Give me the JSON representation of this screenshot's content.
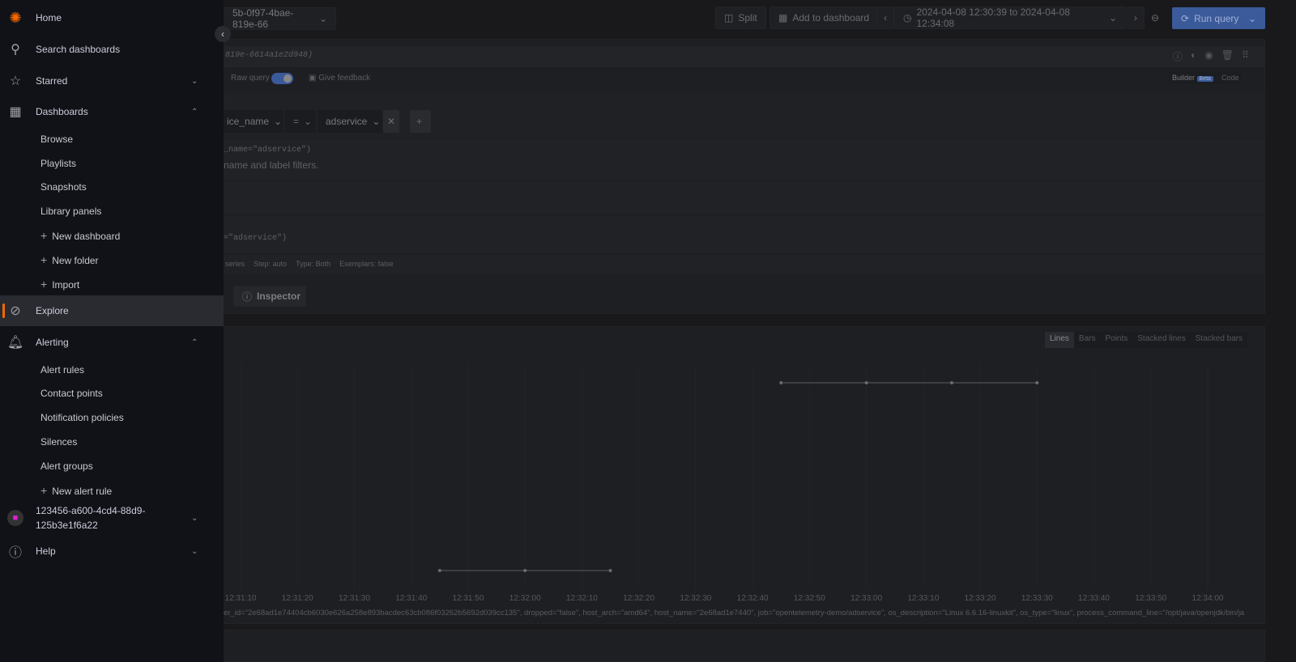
{
  "toolbar": {
    "datasource": "5b-0f97-4bae-819e-66",
    "split": "Split",
    "add_to_dashboard": "Add to dashboard",
    "time_range": "2024-04-08 12:30:39 to 2024-04-08 12:34:08",
    "run_query": "Run query"
  },
  "query": {
    "ref": "819e-6614a1e2d948)",
    "raw_query_label": "Raw query",
    "raw_query_on": true,
    "give_feedback": "Give feedback",
    "builder": "Builder",
    "beta": "Beta",
    "code": "Code",
    "label_name": "ice_name",
    "operator": "=",
    "label_value": "adservice",
    "preview_code": "_name=\"adservice\")",
    "hint": "name and label filters.",
    "raw_code": "=\"adservice\")",
    "options": [
      "series",
      "Step: auto",
      "Type: Both",
      "Exemplars: false"
    ],
    "inspector": "Inspector"
  },
  "graph": {
    "styles": [
      "Lines",
      "Bars",
      "Points",
      "Stacked lines",
      "Stacked bars"
    ],
    "active_style": "Lines",
    "legend": "er_id=\"2e68ad1e74404cb6030e626a258e893bacdec63cb086f03262b5692d039cc135\", dropped=\"false\", host_arch=\"amd64\", host_name=\"2e68ad1e7440\", job=\"opentelemetry-demo/adservice\", os_description=\"Linux 6.6.16-linuxkit\", os_type=\"linux\", process_command_line=\"/opt/java/openjdk/bin/ja"
  },
  "chart_data": {
    "type": "line",
    "xticks": [
      "12:31:10",
      "12:31:20",
      "12:31:30",
      "12:31:40",
      "12:31:50",
      "12:32:00",
      "12:32:10",
      "12:32:20",
      "12:32:30",
      "12:32:40",
      "12:32:50",
      "12:33:00",
      "12:33:10",
      "12:33:20",
      "12:33:30",
      "12:33:40",
      "12:33:50",
      "12:34:00"
    ],
    "segments": [
      {
        "x": [
          "12:31:45",
          "12:32:00",
          "12:32:15"
        ],
        "y": [
          0,
          0,
          0
        ]
      },
      {
        "x": [
          "12:32:45",
          "12:33:00",
          "12:33:15",
          "12:33:30"
        ],
        "y": [
          1,
          1,
          1,
          1
        ]
      }
    ]
  },
  "sidebar": {
    "home": "Home",
    "search": "Search dashboards",
    "starred": "Starred",
    "dashboards": "Dashboards",
    "dash_items": [
      "Browse",
      "Playlists",
      "Snapshots",
      "Library panels"
    ],
    "dash_new": [
      "New dashboard",
      "New folder",
      "Import"
    ],
    "explore": "Explore",
    "alerting": "Alerting",
    "alert_items": [
      "Alert rules",
      "Contact points",
      "Notification policies",
      "Silences",
      "Alert groups"
    ],
    "alert_new": "New alert rule",
    "org_line1": "123456-a600-4cd4-88d9-",
    "org_line2": "125b3e1f6a22",
    "help": "Help",
    "accent": "#f46800"
  }
}
